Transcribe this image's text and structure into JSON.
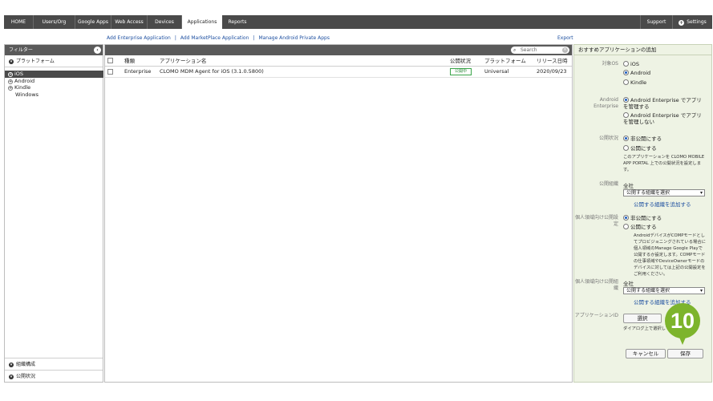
{
  "nav": {
    "tabs": [
      "HOME",
      "Users/Org",
      "Google Apps",
      "Web Access",
      "Devices",
      "Applications",
      "Reports"
    ],
    "active": "Applications",
    "support": "Support",
    "settings": "Settings"
  },
  "sublinks": {
    "add_enterprise": "Add Enterprise Application",
    "add_marketplace": "Add MarketPlace Application",
    "manage_android": "Manage Android Private Apps",
    "separator": "|",
    "export": "Export"
  },
  "filter": {
    "title": "フィルター",
    "platform_section": "プラットフォーム",
    "platforms": [
      {
        "label": "iOS",
        "selected": true,
        "expandable": true
      },
      {
        "label": "Android",
        "selected": false,
        "expandable": true
      },
      {
        "label": "Kindle",
        "selected": false,
        "expandable": true
      },
      {
        "label": "Windows",
        "selected": false,
        "expandable": false
      }
    ],
    "org_section": "組織構成",
    "status_section": "公開状況"
  },
  "table": {
    "search_placeholder": "Search",
    "columns": {
      "type": "種類",
      "name": "アプリケーション名",
      "status": "公開状況",
      "platform": "プラットフォーム",
      "release": "リリース日時"
    },
    "rows": [
      {
        "type": "Enterprise",
        "name": "CLOMO MDM Agent for iOS (3.1.0.5800)",
        "status": "公開中",
        "platform": "Universal",
        "release": "2020/09/23"
      }
    ]
  },
  "right": {
    "title": "おすすめアプリケーションの追加",
    "target_os_label": "対象OS",
    "os_options": [
      "iOS",
      "Android",
      "Kindle"
    ],
    "os_selected": "Android",
    "android_enterprise_label": "Android Enterprise",
    "ae_manage": "Android Enterprise でアプリを管理する",
    "ae_no_manage": "Android Enterprise でアプリを管理しない",
    "publish_label": "公開状況",
    "publish_private": "非公開にする",
    "publish_public": "公開にする",
    "publish_note": "このアプリケーションを CLOMO MOBILE APP PORTAL 上での公開状況を設定します。",
    "org_label": "公開組織",
    "org_value": "全社",
    "org_select": "公開する組織を選択",
    "org_add": "公開する組織を追加する",
    "personal_label": "個人領域向け公開設定",
    "personal_private": "非公開にする",
    "personal_public": "公開にする",
    "personal_note": "AndroidデバイスがCOMPモードとしてプロビジョニングされている場合に個人領域のManage Google Playで公開するか設定します。COMPモードの仕事領域やDeviceOwnerモードのデバイスに対しては上記の公開設定をご利用ください。",
    "personal_org_label": "個人領域向け公開組織",
    "personal_org_value": "全社",
    "personal_org_select": "公開する組織を選択",
    "personal_org_add": "公開する組織を追加する",
    "app_id_label": "アプリケーションID",
    "select_button": "選択",
    "dialog_note": "ダイアログ上で選択して",
    "cancel_button": "キャンセル",
    "save_button": "保存"
  },
  "step_marker": "10",
  "colors": {
    "accent": "#7db42c",
    "nav_bg": "#4a4a4a",
    "link": "#1d4fa0",
    "panel_bg": "#eef3e4"
  }
}
